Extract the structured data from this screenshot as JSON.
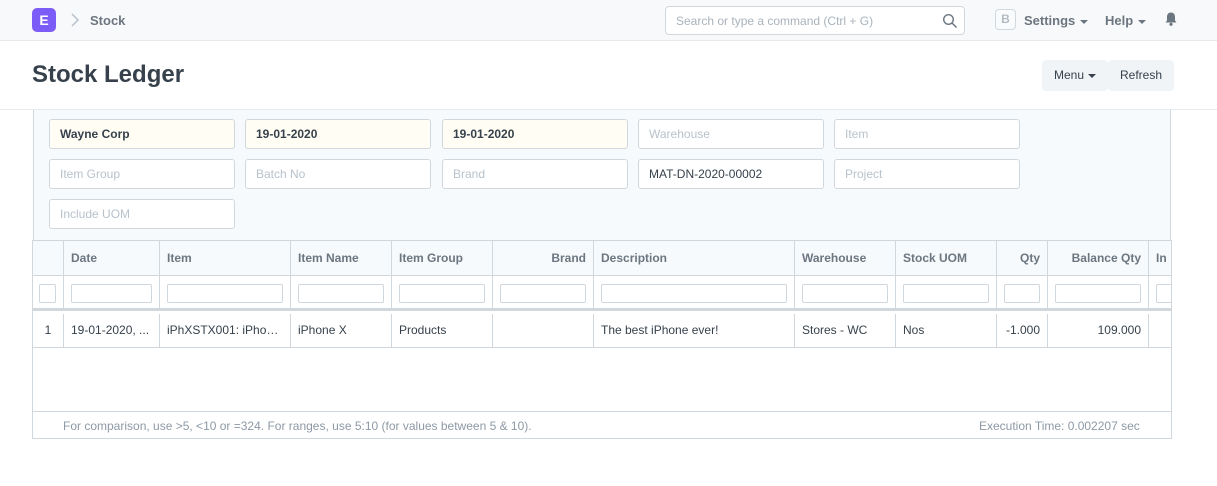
{
  "navbar": {
    "logo_letter": "E",
    "breadcrumb": "Stock",
    "search_placeholder": "Search or type a command (Ctrl + G)",
    "avatar_initial": "B",
    "settings_label": "Settings",
    "help_label": "Help"
  },
  "page": {
    "title": "Stock Ledger",
    "menu_label": "Menu",
    "refresh_label": "Refresh"
  },
  "filters": {
    "company": "Wayne Corp",
    "from_date": "19-01-2020",
    "to_date": "19-01-2020",
    "warehouse_placeholder": "Warehouse",
    "item_placeholder": "Item",
    "item_group_placeholder": "Item Group",
    "batch_no_placeholder": "Batch No",
    "brand_placeholder": "Brand",
    "voucher_no": "MAT-DN-2020-00002",
    "project_placeholder": "Project",
    "include_uom_placeholder": "Include UOM"
  },
  "grid": {
    "columns": [
      "Date",
      "Item",
      "Item Name",
      "Item Group",
      "Brand",
      "Description",
      "Warehouse",
      "Stock UOM",
      "Qty",
      "Balance Qty",
      "In"
    ],
    "rows": [
      {
        "index": "1",
        "date": "19-01-2020, ...",
        "item": "iPhXSTX001: iPhon...",
        "item_name": "iPhone X",
        "item_group": "Products",
        "brand": "",
        "description": "The best iPhone ever!",
        "warehouse": "Stores - WC",
        "stock_uom": "Nos",
        "qty": "-1.000",
        "balance_qty": "109.000"
      }
    ],
    "footer_hint": "For comparison, use >5, <10 or =324. For ranges, use 5:10 (for values between 5 & 10).",
    "execution_time": "Execution Time: 0.002207 sec"
  }
}
